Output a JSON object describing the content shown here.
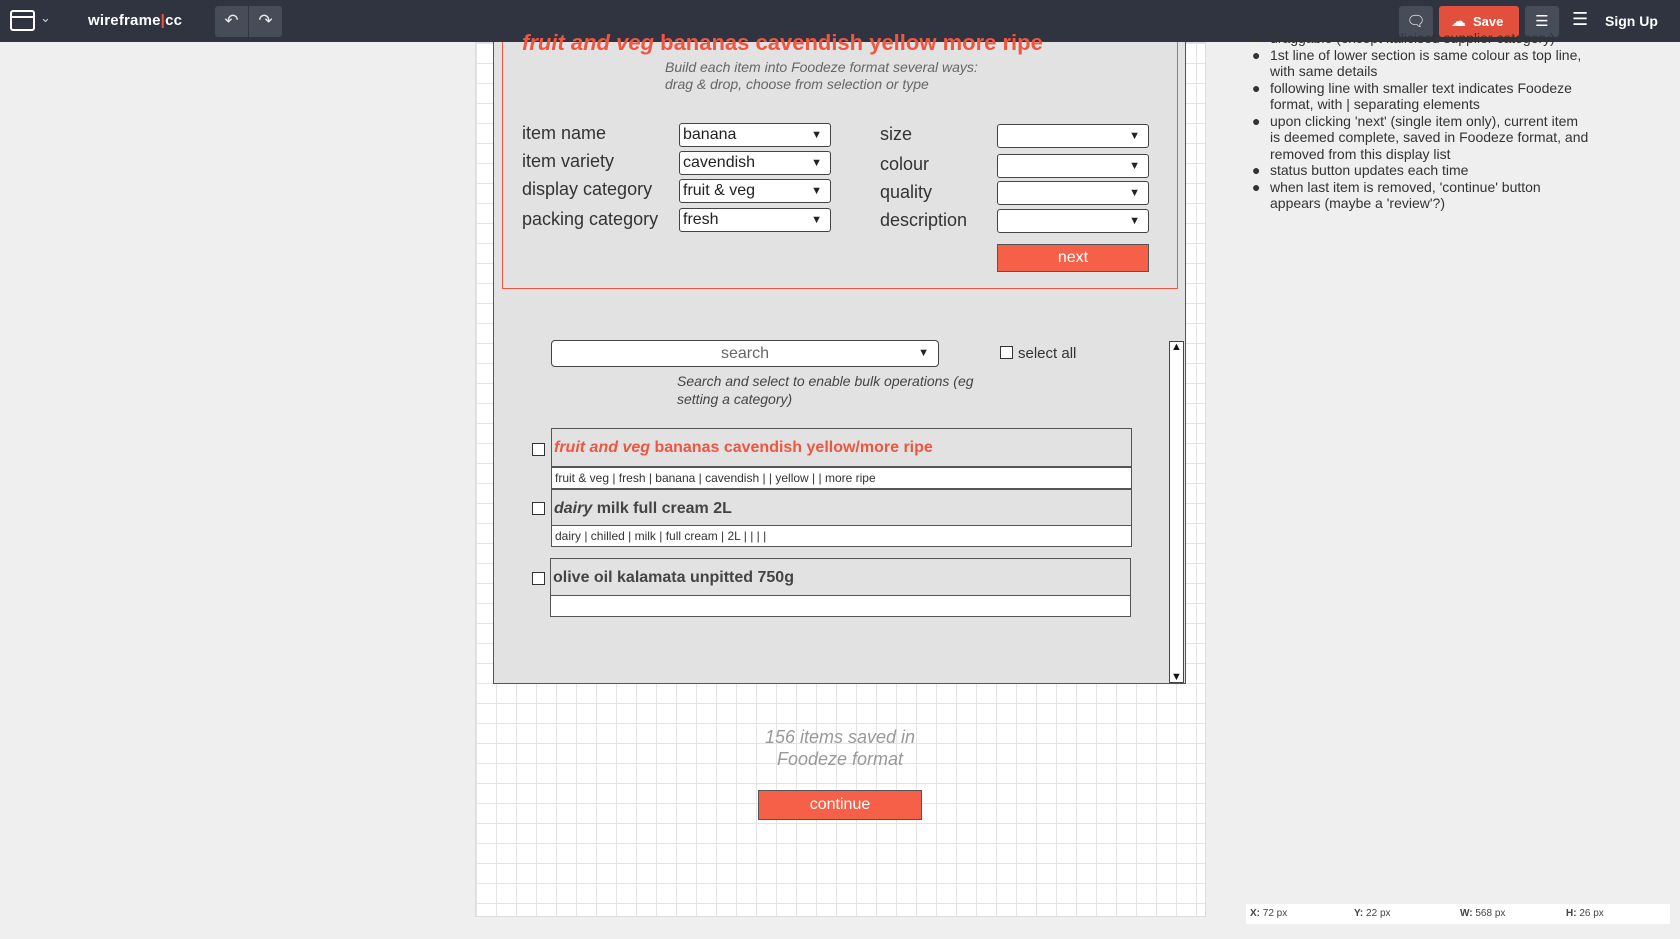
{
  "app": {
    "logo_text": "wireframe",
    "logo_suffix": "cc"
  },
  "toolbar": {
    "undo_glyph": "↶",
    "redo_glyph": "↷",
    "save_label": "Save",
    "signup_label": "Sign Up"
  },
  "form": {
    "title_category": "fruit and veg",
    "title_rest": " bananas cavendish yellow more ripe",
    "hint": "Build each item into Foodeze format several ways: drag & drop, choose from selection or type",
    "fields_left": [
      {
        "label": "item name",
        "value": "banana"
      },
      {
        "label": "item variety",
        "value": "cavendish"
      },
      {
        "label": "display category",
        "value": "fruit & veg"
      },
      {
        "label": "packing category",
        "value": "fresh"
      }
    ],
    "fields_right": [
      {
        "label": "size",
        "value": ""
      },
      {
        "label": "colour",
        "value": ""
      },
      {
        "label": "quality",
        "value": ""
      },
      {
        "label": "description",
        "value": ""
      }
    ],
    "next_label": "next"
  },
  "bulk": {
    "search_placeholder": "search",
    "select_all_label": "select all",
    "hint": "Search and select to enable bulk operations (eg setting a category)"
  },
  "items": [
    {
      "category": "fruit and veg",
      "name": " bananas cavendish yellow/more ripe",
      "format": "fruit & veg | fresh | banana | cavendish |  | yellow |  | more ripe"
    },
    {
      "category": "dairy",
      "name": " milk full cream 2L",
      "format": "dairy | chilled | milk | full cream | 2L |  |  |  | "
    },
    {
      "category": "",
      "name": "olive oil kalamata unpitted 750g",
      "format": ""
    }
  ],
  "footer": {
    "saved_line1": "156 items saved in",
    "saved_line2": "Foodeze format",
    "continue_label": "continue"
  },
  "notes": [
    "draggable (except italicised supplier category)",
    "1st line of lower section is same colour as top line, with same details",
    "following line with smaller text indicates Foodeze format, with | separating elements",
    "upon clicking 'next' (single item only), current item is deemed complete, saved in Foodeze format, and removed from this display list",
    "status button updates each time",
    "when last item is removed, 'continue' button appears (maybe a 'review'?)"
  ],
  "status": {
    "x": "72 px",
    "y": "22 px",
    "w": "568 px",
    "h": "26 px"
  },
  "colors": {
    "accent": "#f0553f",
    "topbar": "#2f3440",
    "panel": "#e2e2e2"
  }
}
